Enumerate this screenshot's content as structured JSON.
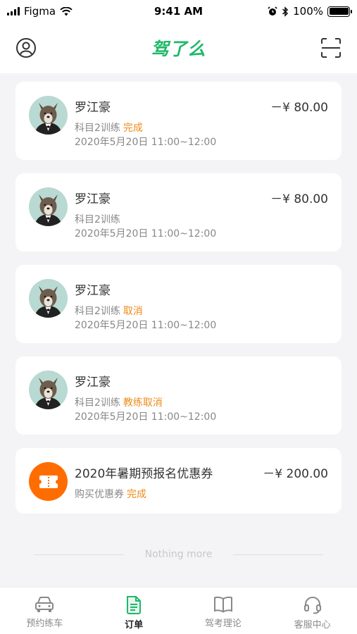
{
  "status_bar": {
    "carrier": "Figma",
    "time": "9:41 AM",
    "battery": "100%",
    "battery_level": 1.0
  },
  "header": {
    "logo": "驾了么",
    "profile_icon": "user-icon",
    "scan_icon": "scan-icon",
    "brand_color": "#1fb86a"
  },
  "orders": [
    {
      "name": "罗江豪",
      "amount": "－¥ 80.00",
      "subject": "科目2训练",
      "status": "完成",
      "time": "2020年5月20日  11:00~12:00"
    },
    {
      "name": "罗江豪",
      "amount": "－¥ 80.00",
      "subject": "科目2训练",
      "status": "",
      "time": "2020年5月20日  11:00~12:00"
    },
    {
      "name": "罗江豪",
      "amount": "",
      "subject": "科目2训练",
      "status": "取消",
      "time": "2020年5月20日  11:00~12:00"
    },
    {
      "name": "罗江豪",
      "amount": "",
      "subject": "科目2训练",
      "status": "教练取消",
      "time": "2020年5月20日  11:00~12:00"
    }
  ],
  "coupon": {
    "name": "2020年暑期预报名优惠券",
    "amount": "－¥ 200.00",
    "subject": "购买优惠券",
    "status": "完成",
    "icon": "ticket-icon",
    "color": "#ff6d00"
  },
  "footer_note": "Nothing more",
  "status_color": "#f08a1a",
  "tabs": [
    {
      "label": "预约练车",
      "icon": "car-icon",
      "active": false
    },
    {
      "label": "订单",
      "icon": "document-icon",
      "active": true
    },
    {
      "label": "驾考理论",
      "icon": "book-icon",
      "active": false
    },
    {
      "label": "客服中心",
      "icon": "headset-icon",
      "active": false
    }
  ]
}
